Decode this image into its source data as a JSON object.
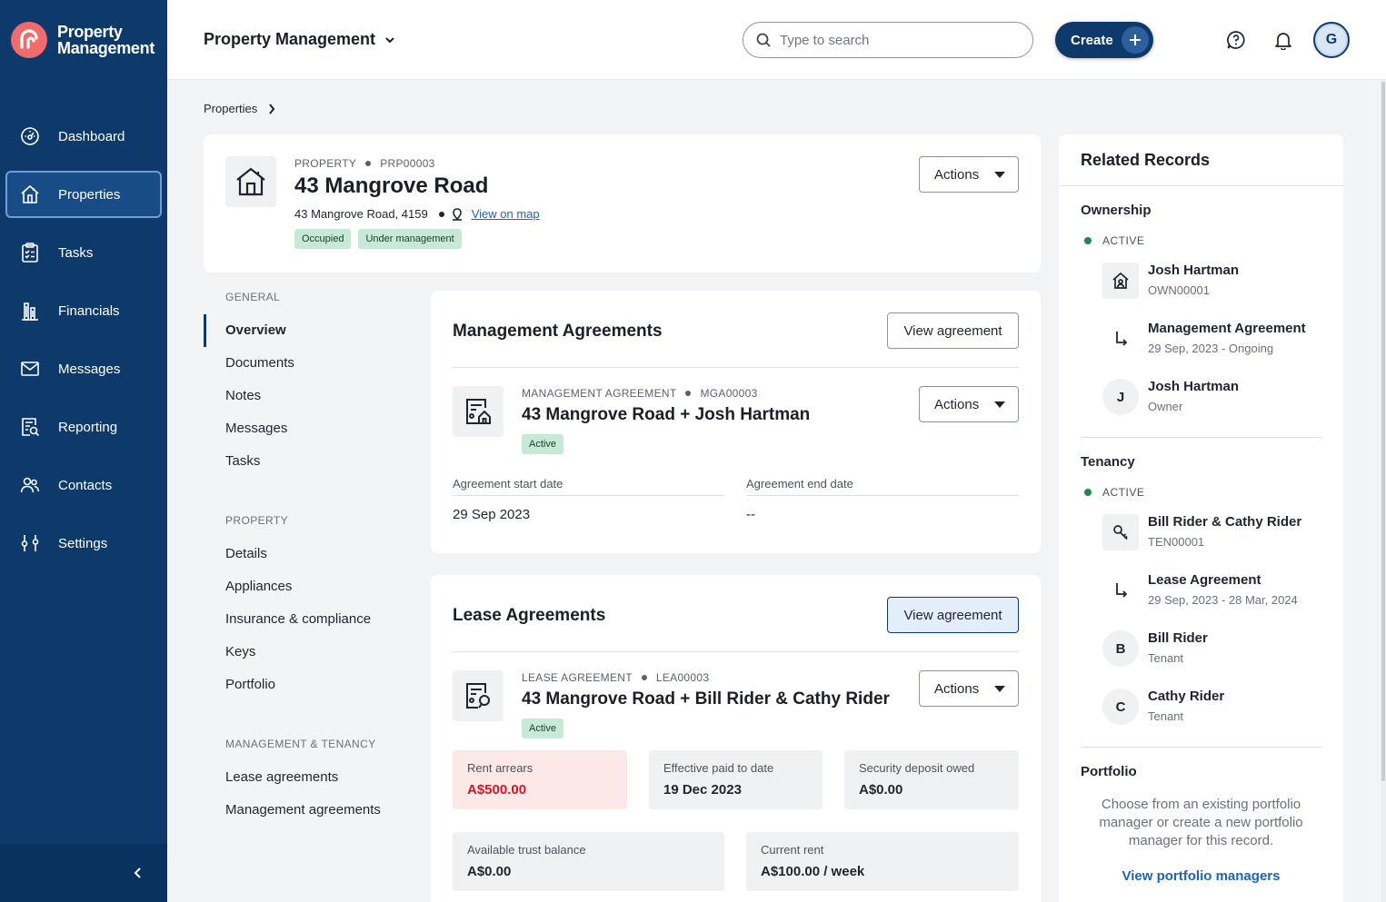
{
  "brand": {
    "line1": "Property",
    "line2": "Management"
  },
  "sidebar": {
    "items": [
      {
        "label": "Dashboard",
        "icon": "dashboard-icon"
      },
      {
        "label": "Properties",
        "icon": "home-icon",
        "active": true
      },
      {
        "label": "Tasks",
        "icon": "clipboard-icon"
      },
      {
        "label": "Financials",
        "icon": "building-chart-icon"
      },
      {
        "label": "Messages",
        "icon": "mail-icon"
      },
      {
        "label": "Reporting",
        "icon": "report-search-icon"
      },
      {
        "label": "Contacts",
        "icon": "people-icon"
      },
      {
        "label": "Settings",
        "icon": "sliders-icon"
      }
    ]
  },
  "header": {
    "title": "Property Management",
    "search_placeholder": "Type to search",
    "create_label": "Create",
    "avatar_initial": "G"
  },
  "breadcrumb": {
    "item": "Properties"
  },
  "property": {
    "type_label": "PROPERTY",
    "id": "PRP00003",
    "title": "43 Mangrove Road",
    "address": "43 Mangrove Road, 4159",
    "map_link": "View on map",
    "badges": [
      "Occupied",
      "Under management"
    ],
    "actions_label": "Actions"
  },
  "subnav": {
    "general_head": "GENERAL",
    "general": [
      "Overview",
      "Documents",
      "Notes",
      "Messages",
      "Tasks"
    ],
    "property_head": "PROPERTY",
    "property": [
      "Details",
      "Appliances",
      "Insurance & compliance",
      "Keys",
      "Portfolio"
    ],
    "mt_head": "MANAGEMENT & TENANCY",
    "mt": [
      "Lease agreements",
      "Management agreements"
    ]
  },
  "management": {
    "section_title": "Management Agreements",
    "view_label": "View agreement",
    "type_label": "MANAGEMENT AGREEMENT",
    "id": "MGA00003",
    "title": "43 Mangrove Road + Josh Hartman",
    "status": "Active",
    "actions_label": "Actions",
    "start_label": "Agreement start date",
    "start_value": "29 Sep 2023",
    "end_label": "Agreement end date",
    "end_value": "--"
  },
  "lease": {
    "section_title": "Lease Agreements",
    "view_label": "View agreement",
    "type_label": "LEASE AGREEMENT",
    "id": "LEA00003",
    "title": "43 Mangrove Road + Bill Rider & Cathy Rider",
    "status": "Active",
    "actions_label": "Actions",
    "stats": [
      {
        "label": "Rent arrears",
        "value": "A$500.00"
      },
      {
        "label": "Effective paid to date",
        "value": "19 Dec 2023"
      },
      {
        "label": "Security deposit owed",
        "value": "A$0.00"
      },
      {
        "label": "Available trust balance",
        "value": "A$0.00"
      },
      {
        "label": "Current rent",
        "value": "A$100.00 / week"
      }
    ]
  },
  "related": {
    "title": "Related Records",
    "ownership": {
      "head": "Ownership",
      "status": "ACTIVE",
      "owner_group": {
        "name": "Josh Hartman",
        "sub": "OWN00001"
      },
      "agreement": {
        "name": "Management Agreement",
        "sub": "29 Sep, 2023 - Ongoing"
      },
      "person": {
        "initial": "J",
        "name": "Josh Hartman",
        "sub": "Owner"
      }
    },
    "tenancy": {
      "head": "Tenancy",
      "status": "ACTIVE",
      "group": {
        "name": "Bill Rider & Cathy Rider",
        "sub": "TEN00001"
      },
      "agreement": {
        "name": "Lease Agreement",
        "sub": "29 Sep, 2023 - 28 Mar, 2024"
      },
      "person1": {
        "initial": "B",
        "name": "Bill Rider",
        "sub": "Tenant"
      },
      "person2": {
        "initial": "C",
        "name": "Cathy Rider",
        "sub": "Tenant"
      }
    },
    "portfolio": {
      "head": "Portfolio",
      "text": "Choose from an existing portfolio manager or create a new portfolio manager for this record.",
      "link": "View portfolio managers"
    }
  },
  "colors": {
    "sidebar": "#0d3a6b",
    "accent": "#f06b6b",
    "link": "#1d64b3",
    "danger": "#d0182a",
    "success": "#1f8a4c"
  }
}
